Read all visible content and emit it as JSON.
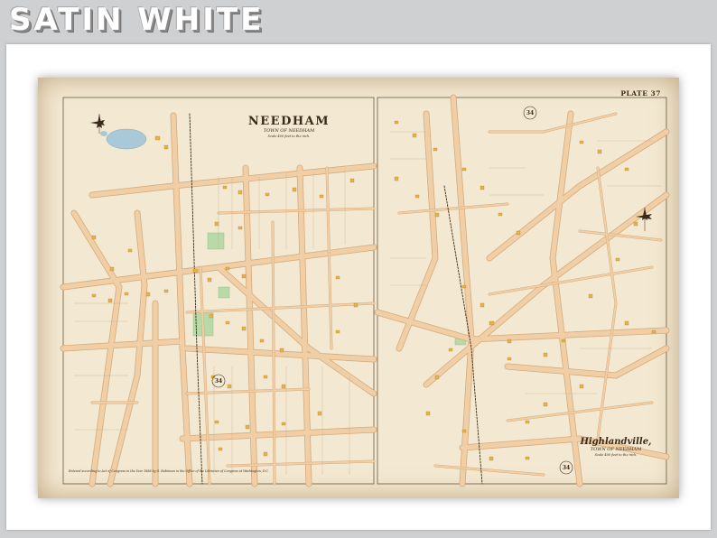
{
  "banner": {
    "text": "SATIN WHITE"
  },
  "map": {
    "plate_label": "PLATE 37",
    "left_title": "NEEDHAM",
    "left_subtitle": "TOWN OF NEEDHAM",
    "left_scale": "Scale 400 feet to the inch.",
    "right_title": "Highlandville,",
    "right_subtitle": "TOWN OF NEEDHAM",
    "right_scale": "Scale 400 feet to the inch.",
    "footer_note": "Entered according to Act of Congress in the Year 1888 by G. Robinson in the Office of the Librarian of Congress at Washington, D.C.",
    "route_numbers": [
      "34",
      "34",
      "34"
    ],
    "colors": {
      "paper": "#f3e9d2",
      "road": "#f0cfa6",
      "road_edge": "#d7aa7c",
      "building": "#e6b24a",
      "water": "#a9c9d8",
      "green": "#b8d9a8",
      "ink": "#3a2a1a"
    }
  }
}
